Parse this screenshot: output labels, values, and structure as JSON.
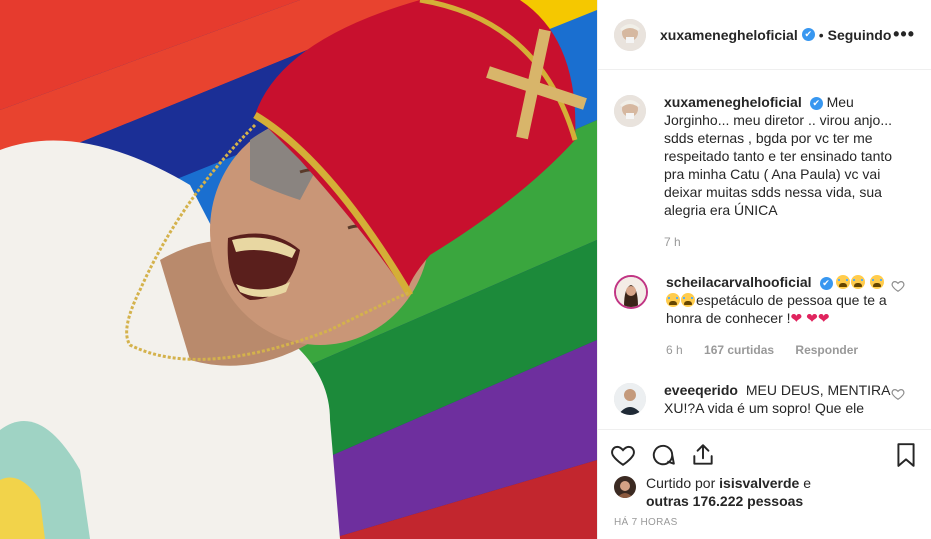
{
  "header": {
    "username": "xuxamenegheloficial",
    "verified": "✔",
    "separator": "•",
    "follow_status": "Seguindo",
    "more": "•••"
  },
  "caption": {
    "username": "xuxamenegheloficial",
    "verified": "✔",
    "text": "Meu Jorginho... meu diretor .. virou anjo... sdds eternas , bgda por vc ter me respeitado tanto e ter ensinado tanto pra minha Catu ( Ana Paula) vc vai deixar muitas sdds nessa vida, sua alegria era ÚNICA",
    "time": "7 h"
  },
  "comments": [
    {
      "username": "scheilacarvalhooficial",
      "verified": "✔",
      "text": "espetáculo de pessoa que te a honra de conhecer !",
      "time": "6 h",
      "likes": "167 curtidas",
      "reply": "Responder"
    },
    {
      "username": "eveeqerido",
      "text": "MEU DEUS, MENTIRA XU!?A vida é um sopro! Que ele"
    }
  ],
  "likes": {
    "prefix": "Curtido por",
    "user": "isisvalverde",
    "joiner": "e",
    "others": "outras 176.222 pessoas"
  },
  "timestamp": "HÁ 7 HORAS",
  "icons": [
    "heart-icon",
    "comment-icon",
    "share-icon",
    "bookmark-icon",
    "more-icon",
    "verified-icon"
  ],
  "colors": {
    "verified": "#3897f0",
    "text": "#262626",
    "muted": "#999999",
    "hat": "#c8102e"
  }
}
